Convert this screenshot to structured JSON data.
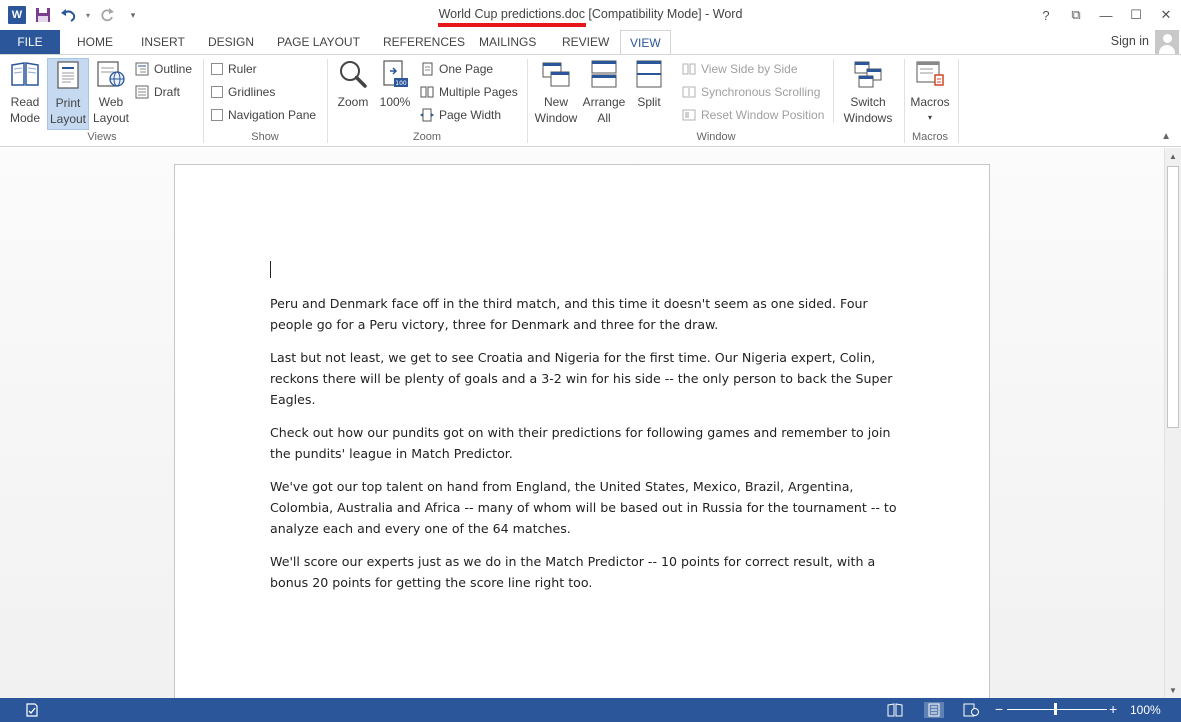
{
  "app": {
    "title": "World Cup predictions.doc [Compatibility Mode] - Word",
    "signin": "Sign in",
    "accent": "#2b579a",
    "title_highlight_color": "#e8151b"
  },
  "qat": {
    "word_logo": "W",
    "icons": [
      "word-logo-icon",
      "save-icon",
      "undo-icon",
      "redo-icon",
      "customize-icon"
    ]
  },
  "window_controls": {
    "help": "?",
    "ribbon_display": "⧉",
    "minimize": "—",
    "maximize": "☐",
    "close": "✕"
  },
  "tabs": {
    "file": "FILE",
    "items": [
      "HOME",
      "INSERT",
      "DESIGN",
      "PAGE LAYOUT",
      "REFERENCES",
      "MAILINGS",
      "REVIEW",
      "VIEW"
    ],
    "active": "VIEW"
  },
  "ribbon": {
    "views": {
      "label": "Views",
      "read_mode": [
        "Read",
        "Mode"
      ],
      "print_layout": [
        "Print",
        "Layout"
      ],
      "web_layout": [
        "Web",
        "Layout"
      ],
      "outline": "Outline",
      "draft": "Draft"
    },
    "show": {
      "label": "Show",
      "ruler": "Ruler",
      "gridlines": "Gridlines",
      "navigation_pane": "Navigation Pane"
    },
    "zoom": {
      "label": "Zoom",
      "zoom": "Zoom",
      "hundred": "100%",
      "one_page": "One Page",
      "multiple_pages": "Multiple Pages",
      "page_width": "Page Width"
    },
    "window": {
      "label": "Window",
      "new_window": [
        "New",
        "Window"
      ],
      "arrange_all": [
        "Arrange",
        "All"
      ],
      "split": "Split",
      "view_side_by_side": "View Side by Side",
      "synchronous_scrolling": "Synchronous Scrolling",
      "reset_window_position": "Reset Window Position",
      "switch_windows": [
        "Switch",
        "Windows"
      ]
    },
    "macros": {
      "label": "Macros",
      "macros": "Macros"
    }
  },
  "document": {
    "paragraphs": [
      "Peru and Denmark face off in the third match, and this time it doesn't seem as one sided. Four people go for a Peru victory, three for Denmark and three for the draw.",
      "Last but not least, we get to see Croatia and Nigeria for the first time. Our Nigeria expert, Colin, reckons there will be plenty of goals and a 3-2 win for his side -- the only person to back the Super Eagles.",
      "Check out how our pundits got on with their predictions for following games and remember to join the pundits' league in Match Predictor.",
      "We've got our top talent on hand from England, the United States, Mexico, Brazil, Argentina, Colombia, Australia and Africa -- many of whom will be based out in Russia for the tournament -- to analyze each and every one of the 64 matches.",
      "We'll score our experts just as we do in the Match Predictor -- 10 points for correct result, with a bonus 20 points for getting the score line right too."
    ]
  },
  "statusbar": {
    "zoom_percent": "100%",
    "zoom_minus": "−",
    "zoom_plus": "+",
    "zoom_level": 0.5
  }
}
